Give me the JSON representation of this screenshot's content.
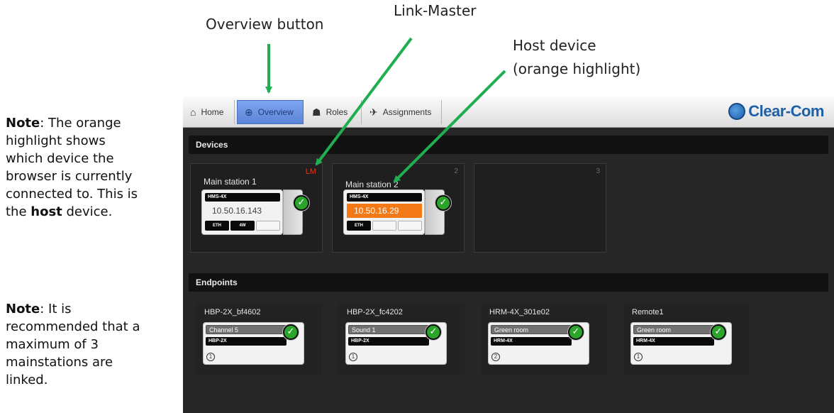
{
  "callouts": {
    "overview_button": "Overview button",
    "link_master": "Link-Master",
    "host_device_line1": "Host device",
    "host_device_line2": "(orange highlight)"
  },
  "notes": {
    "note1": {
      "bold": "Note",
      "lines": [
        ": The orange",
        "highlight shows",
        "which device the",
        "browser is currently",
        "connected to. This is"
      ],
      "last_prefix": "the ",
      "last_bold": "host",
      "last_suffix": " device."
    },
    "note2": {
      "bold": "Note",
      "lines": [
        ": It is",
        "recommended that a",
        "maximum of 3",
        "mainstations are",
        "linked."
      ]
    }
  },
  "app": {
    "tabs": [
      {
        "label": "Home",
        "icon": "home-icon",
        "glyph": "⌂"
      },
      {
        "label": "Overview",
        "icon": "globe-icon",
        "glyph": "⊕"
      },
      {
        "label": "Roles",
        "icon": "users-icon",
        "glyph": "☗"
      },
      {
        "label": "Assignments",
        "icon": "split-arrows-icon",
        "glyph": "✈"
      }
    ],
    "active_tab": "Overview",
    "logo_text": "Clear-Com",
    "sections": {
      "devices": "Devices",
      "endpoints": "Endpoints"
    },
    "devices": [
      {
        "name": "Main station 1",
        "slot": "LM",
        "model": "HMS-4X",
        "ip": "10.50.16.143",
        "host": false,
        "ports": [
          "ETH",
          "4W",
          ""
        ]
      },
      {
        "name": "Main station 2",
        "slot": "2",
        "model": "HMS-4X",
        "ip": "10.50.16.29",
        "host": true,
        "ports": [
          "ETH",
          "",
          ""
        ]
      },
      {
        "name": "",
        "slot": "3"
      }
    ],
    "endpoints": [
      {
        "name": "HBP-2X_bf4602",
        "label": "Channel 5",
        "model": "HBP-2X",
        "index": "1"
      },
      {
        "name": "HBP-2X_fc4202",
        "label": "Sound 1",
        "model": "HBP-2X",
        "index": "1"
      },
      {
        "name": "HRM-4X_301e02",
        "label": "Green room",
        "model": "HRM-4X",
        "index": "2"
      },
      {
        "name": "Remote1",
        "label": "Green room",
        "model": "HRM-4X",
        "index": "1"
      }
    ],
    "colors": {
      "host_highlight": "#f37a16",
      "link_master": "#e03818",
      "active_tab": "#6a93e3",
      "status_ok": "#2aa52a",
      "arrows": "#1fae50"
    }
  }
}
